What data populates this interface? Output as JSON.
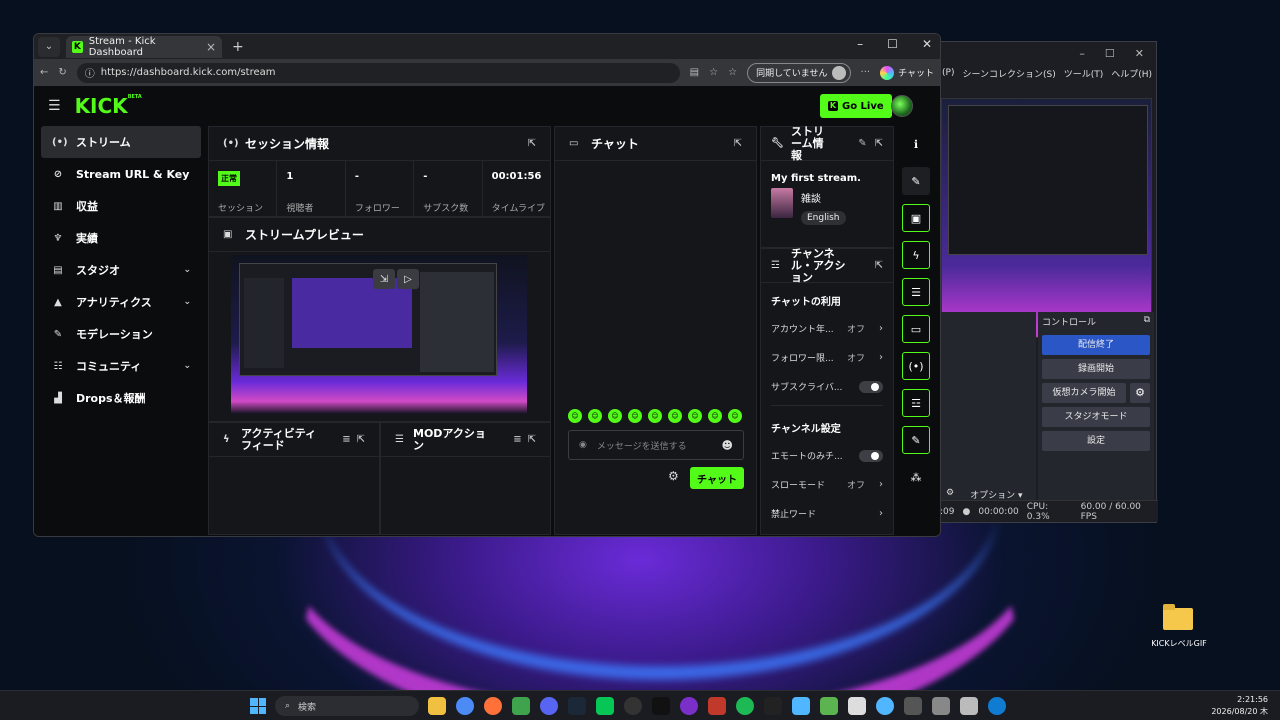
{
  "browser": {
    "tab_title": "Stream - Kick Dashboard",
    "url": "https://dashboard.kick.com/stream",
    "sync_label": "同期していません",
    "copilot_label": "チャット"
  },
  "kick": {
    "logo": "KICK",
    "logo_beta": "BETA",
    "go_live": "Go Live",
    "sidebar": [
      {
        "label": "ストリーム",
        "icon": "broadcast-icon",
        "glyph": "(•)",
        "active": true
      },
      {
        "label": "Stream URL & Key",
        "icon": "link-icon",
        "glyph": "⊘"
      },
      {
        "label": "収益",
        "icon": "chart-icon",
        "glyph": "▥"
      },
      {
        "label": "実績",
        "icon": "trophy-icon",
        "glyph": "♆"
      },
      {
        "label": "スタジオ",
        "icon": "studio-icon",
        "glyph": "▤",
        "chevron": true
      },
      {
        "label": "アナリティクス",
        "icon": "analytics-icon",
        "glyph": "▲",
        "chevron": true
      },
      {
        "label": "モデレーション",
        "icon": "wrench-icon",
        "glyph": "✎"
      },
      {
        "label": "コミュニティ",
        "icon": "community-icon",
        "glyph": "☷",
        "chevron": true
      },
      {
        "label": "Drops＆報酬",
        "icon": "drops-icon",
        "glyph": "▟"
      }
    ],
    "session": {
      "title": "セッション情報",
      "stats": [
        {
          "value": "正常",
          "label": "セッション",
          "badge": true
        },
        {
          "value": "1",
          "label": "視聴者"
        },
        {
          "value": "-",
          "label": "フォロワー"
        },
        {
          "value": "-",
          "label": "サブスク数"
        },
        {
          "value": "00:01:56",
          "label": "タイムライブ"
        }
      ]
    },
    "preview": {
      "title": "ストリームプレビュー"
    },
    "activity": {
      "title": "アクティビティフィード"
    },
    "mod_actions": {
      "title": "MODアクション"
    },
    "chat": {
      "title": "チャット",
      "placeholder": "メッセージを送信する",
      "send_label": "チャット"
    },
    "stream_info": {
      "title": "ストリーム情報",
      "stream_title": "My first stream.",
      "category": "雑談",
      "language": "English"
    },
    "channel_actions": {
      "title": "チャンネル・アクション",
      "chat_usage_title": "チャットの利用",
      "chat_usage": [
        {
          "label": "アカウント年...",
          "value": "オフ"
        },
        {
          "label": "フォロワー限...",
          "value": "オフ"
        },
        {
          "label": "サブスクライバ...",
          "toggle": true
        }
      ],
      "channel_settings_title": "チャンネル設定",
      "channel_settings": [
        {
          "label": "エモートのみチ...",
          "toggle": true
        },
        {
          "label": "スローモード",
          "value": "オフ"
        },
        {
          "label": "禁止ワード",
          "value": ""
        }
      ]
    }
  },
  "obs": {
    "menu": [
      "(P)",
      "シーンコレクション(S)",
      "ツール(T)",
      "ヘルプ(H)"
    ],
    "controls_title": "コントロール",
    "controls": [
      "配信終了",
      "録画開始",
      "仮想カメラ開始",
      "スタジオモード",
      "設定"
    ],
    "options_label": "オプション",
    "status": {
      "time1": ":09",
      "time2": "00:00:00",
      "cpu": "CPU: 0.3%",
      "fps": "60.00 / 60.00 FPS"
    }
  },
  "desktop": {
    "folder_label": "KICKレベルGIF"
  },
  "taskbar": {
    "search": "検索",
    "time": "2:21:56",
    "date": "2026/08/20 木"
  },
  "colors": {
    "accent": "#53fc18",
    "panel": "#15161a",
    "obs_active": "#2a56c6"
  }
}
